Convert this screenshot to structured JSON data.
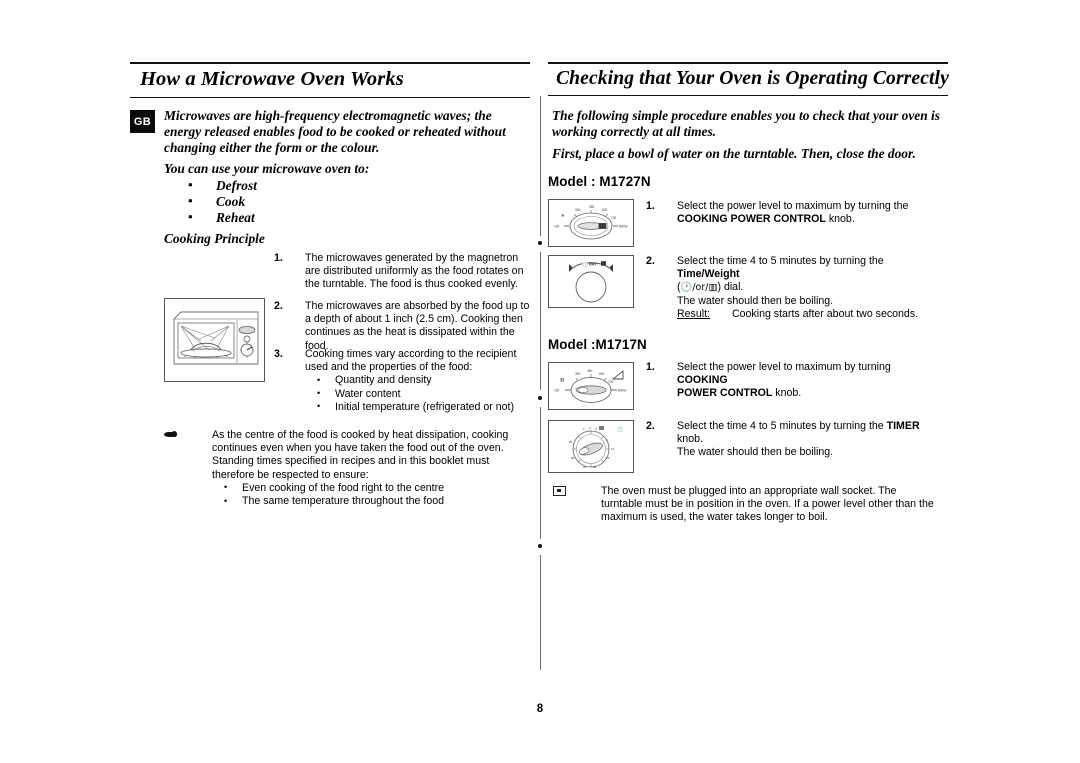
{
  "page": {
    "number": "8",
    "language_badge": "GB"
  },
  "left_column": {
    "heading": "How a Microwave Oven Works",
    "intro_paragraph": "Microwaves are high-frequency electromagnetic waves; the energy released enables food to be cooked or reheated without changing either the form or the colour.",
    "use_lead": "You can use your microwave oven to:",
    "uses": [
      "Defrost",
      "Cook",
      "Reheat"
    ],
    "sub_heading": "Cooking Principle",
    "principles": [
      {
        "number": "1.",
        "text": "The microwaves generated by the magnetron are distributed uniformly as the food rotates on the turntable. The food is thus cooked evenly."
      },
      {
        "number": "2.",
        "text": "The microwaves are absorbed by the food up to a depth of about 1 inch (2.5 cm). Cooking then continues as the heat is dissipated within the food."
      },
      {
        "number": "3.",
        "text": "Cooking times vary according to the recipient used and the properties of the food:",
        "bullets": [
          "Quantity and density",
          "Water content",
          "Initial temperature (refrigerated or not)"
        ]
      }
    ],
    "note": {
      "icon": "pointing-hand-icon",
      "text": "As the centre of the food is cooked by heat dissipation, cooking continues even when you have taken the food out of the oven. Standing times specified in recipes and in this booklet must therefore be respected to ensure:",
      "bullets": [
        "Even cooking of the food right to the centre",
        "The same temperature throughout the food"
      ]
    },
    "figure": {
      "name": "microwave-oven-cutaway-illustration"
    }
  },
  "right_column": {
    "heading": "Checking that Your Oven is Operating Correctly",
    "intro_paragraph_1": "The following simple procedure enables you to check that your oven is working correctly at all times.",
    "intro_paragraph_2": "First, place a bowl of water on the turntable. Then, close the door.",
    "models": [
      {
        "title": "Model : M1727N",
        "steps": [
          {
            "number": "1.",
            "figure": "cooking-power-control-knob-figure",
            "lines": [
              {
                "prefix": "Select the power level to maximum by turning the ",
                "bold": "",
                "suffix": ""
              },
              {
                "prefix": "",
                "bold": "COOKING POWER CONTROL",
                "suffix": " knob."
              }
            ]
          },
          {
            "number": "2.",
            "figure": "time-weight-dial-figure",
            "lines": [
              {
                "prefix": "Select the time 4 to 5 minutes by turning the ",
                "bold": "Time/Weight",
                "suffix": ""
              },
              {
                "prefix": "(",
                "bold": "",
                "suffix": ") dial."
              },
              {
                "prefix": "The water should then be boiling.",
                "bold": "",
                "suffix": ""
              }
            ],
            "result_label": "Result:",
            "result_text": "Cooking starts after about two seconds."
          }
        ]
      },
      {
        "title": "Model :M1717N",
        "steps": [
          {
            "number": "1.",
            "figure": "power-level-knob-figure",
            "lines": [
              {
                "prefix": "Select the power level to maximum by turning ",
                "bold": "COOKING",
                "suffix": ""
              },
              {
                "prefix": "",
                "bold": "POWER CONTROL",
                "suffix": " knob."
              }
            ]
          },
          {
            "number": "2.",
            "figure": "timer-knob-figure",
            "lines": [
              {
                "prefix": "Select the time 4 to 5 minutes by turning the ",
                "bold": "TIMER",
                "suffix": " knob."
              },
              {
                "prefix": "The water should then be boiling.",
                "bold": "",
                "suffix": ""
              }
            ]
          }
        ]
      }
    ],
    "note": {
      "icon": "wall-socket-icon",
      "text": "The oven must be plugged into an appropriate wall socket. The turntable must be in position in the oven. If a power level other than the maximum is used, the water takes longer to boil."
    },
    "dial_labels": {
      "power_knob_values": [
        "300",
        "450",
        "600",
        "700",
        "800W",
        "100"
      ],
      "timer_values": [
        "1",
        "2",
        "3",
        "4",
        "5",
        "10",
        "15",
        "20",
        "25",
        "30"
      ],
      "time_weight_caption": "Time/Weight"
    }
  }
}
